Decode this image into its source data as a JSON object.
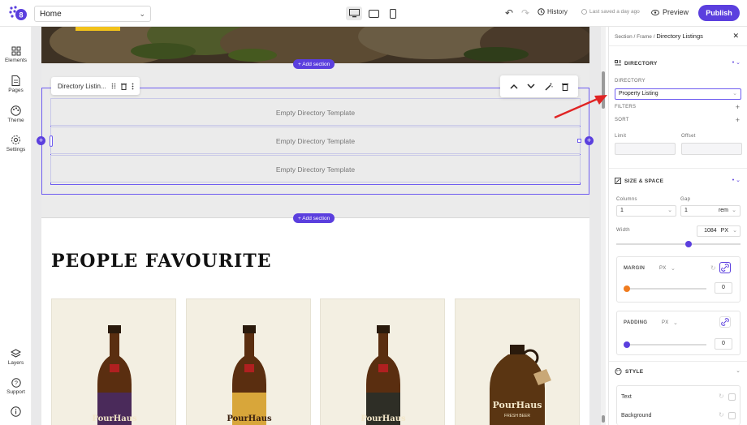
{
  "topbar": {
    "page_selected": "Home",
    "history_label": "History",
    "saved_label": "Last saved a day ago",
    "preview_label": "Preview",
    "publish_label": "Publish"
  },
  "leftbar": {
    "items": [
      {
        "label": "Elements",
        "icon": "elements-icon"
      },
      {
        "label": "Pages",
        "icon": "pages-icon"
      },
      {
        "label": "Theme",
        "icon": "theme-icon"
      },
      {
        "label": "Settings",
        "icon": "settings-icon"
      }
    ],
    "bottom": [
      {
        "label": "Layers",
        "icon": "layers-icon"
      },
      {
        "label": "Support",
        "icon": "support-icon"
      }
    ]
  },
  "canvas": {
    "add_section_label": "+ Add section",
    "directory_toolbar_label": "Directory Listin...",
    "empty_rows": [
      "Empty Directory Template",
      "Empty Directory Template",
      "Empty Directory Template"
    ],
    "section_title": "PEOPLE FAVOURITE",
    "card_brand": "PourHaus",
    "growler_subtext": "FRESH BEER"
  },
  "panel": {
    "breadcrumb": [
      "Section",
      "Frame",
      "Directory Listings"
    ],
    "directory": {
      "heading": "DIRECTORY",
      "label": "DIRECTORY",
      "selected": "Property Listing",
      "filters_label": "FILTERS",
      "sort_label": "SORT",
      "limit_label": "Limit",
      "offset_label": "Offset",
      "limit_value": "",
      "offset_value": ""
    },
    "size_space": {
      "heading": "SIZE & SPACE",
      "columns_label": "Columns",
      "columns_value": "1",
      "gap_label": "Gap",
      "gap_value": "1",
      "gap_unit": "rem",
      "width_label": "Width",
      "width_value": "1084",
      "width_unit": "PX",
      "width_level": 0.58,
      "margin_label": "MARGIN",
      "margin_unit": "PX",
      "margin_value": "0",
      "padding_label": "PADDING",
      "padding_unit": "PX",
      "padding_value": "0"
    },
    "style": {
      "heading": "STYLE",
      "text_label": "Text",
      "background_label": "Background"
    }
  },
  "colors": {
    "accent": "#5b3fde",
    "margin_dot": "#f07c1f",
    "padding_dot": "#5b3fde",
    "arrow": "#e02424"
  }
}
